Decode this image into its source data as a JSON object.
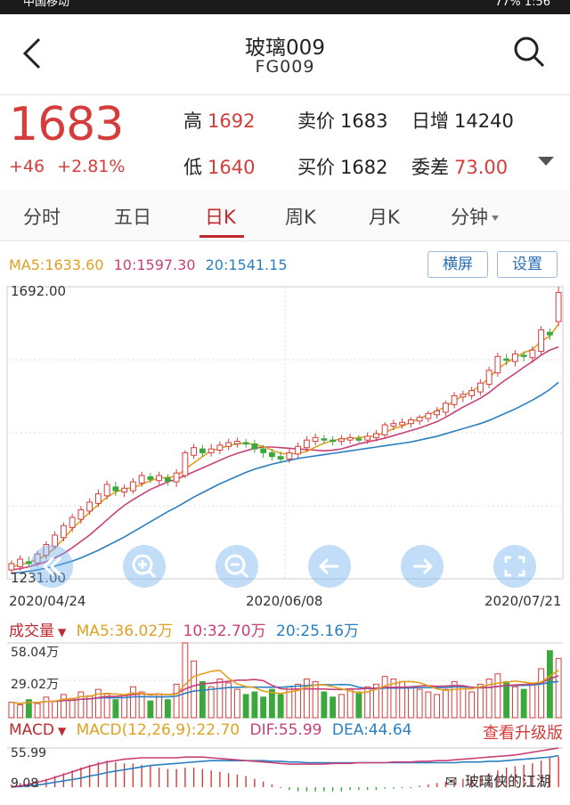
{
  "statusbar": {
    "left": "中国移动",
    "right": "77% 1:56"
  },
  "header": {
    "title": "玻璃009",
    "subtitle": "FG009"
  },
  "quote": {
    "price": "1683",
    "change": "+46",
    "change_pct": "+2.81%",
    "high_label": "高",
    "high": "1692",
    "low_label": "低",
    "low": "1640",
    "ask_label": "卖价",
    "ask": "1683",
    "bid_label": "买价",
    "bid": "1682",
    "daily_inc_label": "日增",
    "daily_inc": "14240",
    "order_diff_label": "委差",
    "order_diff": "73.00"
  },
  "tabs": [
    "分时",
    "五日",
    "日K",
    "周K",
    "月K",
    "分钟"
  ],
  "active_tab": "日K",
  "ma": {
    "ma5": "MA5:1633.60",
    "ma10": "10:1597.30",
    "ma20": "20:1541.15"
  },
  "buttons": {
    "landscape": "横屏",
    "settings": "设置"
  },
  "axis": {
    "top": "1692.00",
    "bottom": "1231.00",
    "date_start": "2020/04/24",
    "date_mid": "2020/06/08",
    "date_end": "2020/07/21"
  },
  "volume": {
    "label": "成交量",
    "ma5": "MA5:36.02万",
    "ma10": "10:32.70万",
    "ma20": "20:25.16万",
    "top": "58.04万",
    "mid": "29.02万"
  },
  "macd": {
    "label": "MACD",
    "params": "MACD(12,26,9):22.70",
    "dif": "DIF:55.99",
    "dea": "DEA:44.64",
    "top": "55.99",
    "mid": "9.08",
    "upgrade": "查看升级版"
  },
  "watermark": "玻璃侠的江湖",
  "colors": {
    "up": "#d63c3c",
    "down": "#3aa83a",
    "ma5": "#e0a020",
    "ma10": "#c84078",
    "ma20": "#2a7fc0",
    "accent": "#c0282f"
  },
  "chart_data": {
    "type": "candlestick",
    "ylim": [
      1231,
      1692
    ],
    "x_ticks": [
      "2020/04/24",
      "2020/06/08",
      "2020/07/21"
    ],
    "candles": [
      [
        1245,
        1255,
        1238,
        1260
      ],
      [
        1250,
        1262,
        1244,
        1268
      ],
      [
        1258,
        1255,
        1250,
        1266
      ],
      [
        1256,
        1270,
        1250,
        1275
      ],
      [
        1268,
        1285,
        1262,
        1290
      ],
      [
        1282,
        1300,
        1278,
        1306
      ],
      [
        1296,
        1315,
        1290,
        1320
      ],
      [
        1312,
        1328,
        1305,
        1334
      ],
      [
        1325,
        1340,
        1318,
        1346
      ],
      [
        1338,
        1352,
        1332,
        1358
      ],
      [
        1350,
        1365,
        1344,
        1372
      ],
      [
        1362,
        1380,
        1356,
        1386
      ],
      [
        1376,
        1370,
        1362,
        1384
      ],
      [
        1368,
        1374,
        1360,
        1380
      ],
      [
        1370,
        1384,
        1365,
        1390
      ],
      [
        1382,
        1394,
        1376,
        1400
      ],
      [
        1392,
        1388,
        1382,
        1398
      ],
      [
        1386,
        1394,
        1380,
        1400
      ],
      [
        1390,
        1385,
        1378,
        1396
      ],
      [
        1384,
        1398,
        1376,
        1404
      ],
      [
        1394,
        1430,
        1390,
        1434
      ],
      [
        1426,
        1438,
        1420,
        1444
      ],
      [
        1436,
        1430,
        1424,
        1442
      ],
      [
        1430,
        1436,
        1424,
        1444
      ],
      [
        1434,
        1442,
        1428,
        1448
      ],
      [
        1440,
        1446,
        1434,
        1452
      ],
      [
        1444,
        1448,
        1438,
        1454
      ],
      [
        1446,
        1444,
        1438,
        1452
      ],
      [
        1444,
        1436,
        1430,
        1450
      ],
      [
        1436,
        1430,
        1422,
        1442
      ],
      [
        1430,
        1424,
        1418,
        1436
      ],
      [
        1424,
        1420,
        1414,
        1432
      ],
      [
        1420,
        1430,
        1414,
        1436
      ],
      [
        1428,
        1440,
        1422,
        1446
      ],
      [
        1438,
        1450,
        1432,
        1456
      ],
      [
        1448,
        1454,
        1442,
        1460
      ],
      [
        1452,
        1450,
        1444,
        1458
      ],
      [
        1450,
        1448,
        1442,
        1456
      ],
      [
        1448,
        1452,
        1442,
        1458
      ],
      [
        1450,
        1454,
        1444,
        1460
      ],
      [
        1452,
        1450,
        1446,
        1458
      ],
      [
        1450,
        1456,
        1444,
        1462
      ],
      [
        1454,
        1460,
        1448,
        1466
      ],
      [
        1458,
        1474,
        1452,
        1478
      ],
      [
        1472,
        1476,
        1466,
        1482
      ],
      [
        1474,
        1478,
        1468,
        1484
      ],
      [
        1476,
        1482,
        1470,
        1486
      ],
      [
        1480,
        1486,
        1474,
        1490
      ],
      [
        1484,
        1492,
        1478,
        1496
      ],
      [
        1490,
        1496,
        1484,
        1502
      ],
      [
        1494,
        1508,
        1488,
        1512
      ],
      [
        1506,
        1520,
        1500,
        1526
      ],
      [
        1518,
        1522,
        1510,
        1528
      ],
      [
        1520,
        1528,
        1514,
        1534
      ],
      [
        1526,
        1540,
        1520,
        1546
      ],
      [
        1538,
        1560,
        1532,
        1566
      ],
      [
        1556,
        1582,
        1550,
        1588
      ],
      [
        1578,
        1576,
        1568,
        1586
      ],
      [
        1574,
        1586,
        1566,
        1592
      ],
      [
        1584,
        1582,
        1574,
        1590
      ],
      [
        1580,
        1592,
        1572,
        1598
      ],
      [
        1590,
        1624,
        1584,
        1630
      ],
      [
        1620,
        1616,
        1608,
        1626
      ],
      [
        1637,
        1683,
        1630,
        1692
      ]
    ],
    "ma5": [
      1250,
      1253,
      1257,
      1262,
      1268,
      1280,
      1294,
      1310,
      1323,
      1336,
      1348,
      1360,
      1368,
      1373,
      1375,
      1380,
      1386,
      1390,
      1391,
      1393,
      1404,
      1414,
      1424,
      1433,
      1437,
      1441,
      1444,
      1445,
      1443,
      1440,
      1434,
      1429,
      1428,
      1429,
      1432,
      1439,
      1445,
      1449,
      1452,
      1452,
      1454,
      1455,
      1457,
      1462,
      1468,
      1472,
      1478,
      1484,
      1490,
      1496,
      1503,
      1512,
      1520,
      1527,
      1536,
      1548,
      1562,
      1572,
      1580,
      1588,
      1593,
      1606,
      1614,
      1633
    ],
    "ma10": [
      1245,
      1247,
      1250,
      1254,
      1258,
      1264,
      1271,
      1280,
      1290,
      1300,
      1312,
      1324,
      1336,
      1347,
      1356,
      1364,
      1372,
      1378,
      1384,
      1388,
      1394,
      1400,
      1406,
      1412,
      1418,
      1424,
      1429,
      1433,
      1437,
      1439,
      1439,
      1438,
      1437,
      1436,
      1435,
      1434,
      1433,
      1434,
      1436,
      1440,
      1444,
      1447,
      1450,
      1453,
      1457,
      1461,
      1465,
      1469,
      1474,
      1479,
      1486,
      1494,
      1502,
      1509,
      1516,
      1525,
      1536,
      1546,
      1555,
      1565,
      1574,
      1584,
      1592,
      1597
    ],
    "ma20": [
      1240,
      1241,
      1243,
      1245,
      1248,
      1251,
      1255,
      1259,
      1264,
      1270,
      1276,
      1283,
      1290,
      1297,
      1305,
      1313,
      1321,
      1329,
      1337,
      1344,
      1352,
      1360,
      1367,
      1374,
      1381,
      1387,
      1393,
      1399,
      1404,
      1408,
      1412,
      1415,
      1418,
      1421,
      1423,
      1425,
      1427,
      1429,
      1431,
      1433,
      1435,
      1437,
      1439,
      1441,
      1443,
      1445,
      1447,
      1450,
      1453,
      1456,
      1460,
      1464,
      1468,
      1472,
      1476,
      1481,
      1487,
      1493,
      1499,
      1506,
      1513,
      1521,
      1530,
      1541
    ],
    "volume": [
      12,
      10,
      14,
      11,
      16,
      13,
      18,
      15,
      20,
      17,
      22,
      19,
      14,
      17,
      24,
      20,
      13,
      18,
      14,
      26,
      58,
      44,
      28,
      24,
      30,
      27,
      22,
      18,
      20,
      16,
      22,
      18,
      24,
      26,
      30,
      28,
      20,
      16,
      18,
      22,
      20,
      24,
      26,
      32,
      30,
      28,
      24,
      22,
      20,
      18,
      22,
      28,
      24,
      20,
      26,
      30,
      34,
      28,
      24,
      22,
      26,
      38,
      52,
      46
    ],
    "macd_hist": [
      2,
      3,
      4,
      5,
      6,
      8,
      10,
      12,
      14,
      16,
      18,
      19,
      18,
      17,
      17,
      16,
      15,
      14,
      13,
      13,
      14,
      14,
      13,
      12,
      11,
      10,
      9,
      8,
      6,
      4,
      2,
      0,
      -2,
      -3,
      -3,
      -3,
      -3,
      -3,
      -3,
      -2,
      -2,
      -2,
      -2,
      -1,
      -1,
      0,
      0,
      1,
      2,
      3,
      4,
      5,
      6,
      7,
      8,
      10,
      12,
      14,
      15,
      16,
      17,
      19,
      21,
      22
    ],
    "dif": [
      0,
      2,
      4,
      7,
      10,
      14,
      18,
      22,
      26,
      30,
      33,
      36,
      38,
      40,
      41,
      42,
      42,
      42,
      42,
      42,
      43,
      43,
      43,
      42,
      41,
      40,
      39,
      38,
      37,
      36,
      35,
      34,
      33,
      33,
      33,
      33,
      33,
      34,
      34,
      34,
      35,
      35,
      35,
      35,
      36,
      36,
      36,
      37,
      37,
      38,
      38,
      39,
      40,
      41,
      42,
      43,
      44,
      45,
      46,
      48,
      50,
      52,
      54,
      56
    ],
    "dea": [
      0,
      1,
      2,
      3,
      5,
      7,
      9,
      11,
      13,
      16,
      18,
      21,
      23,
      25,
      27,
      29,
      31,
      32,
      33,
      34,
      35,
      36,
      37,
      38,
      38,
      38,
      38,
      38,
      38,
      38,
      37,
      37,
      36,
      36,
      35,
      35,
      35,
      35,
      35,
      35,
      35,
      35,
      35,
      35,
      35,
      35,
      35,
      35,
      35,
      35,
      35,
      35,
      36,
      36,
      36,
      37,
      37,
      38,
      39,
      40,
      41,
      42,
      43,
      45
    ]
  }
}
